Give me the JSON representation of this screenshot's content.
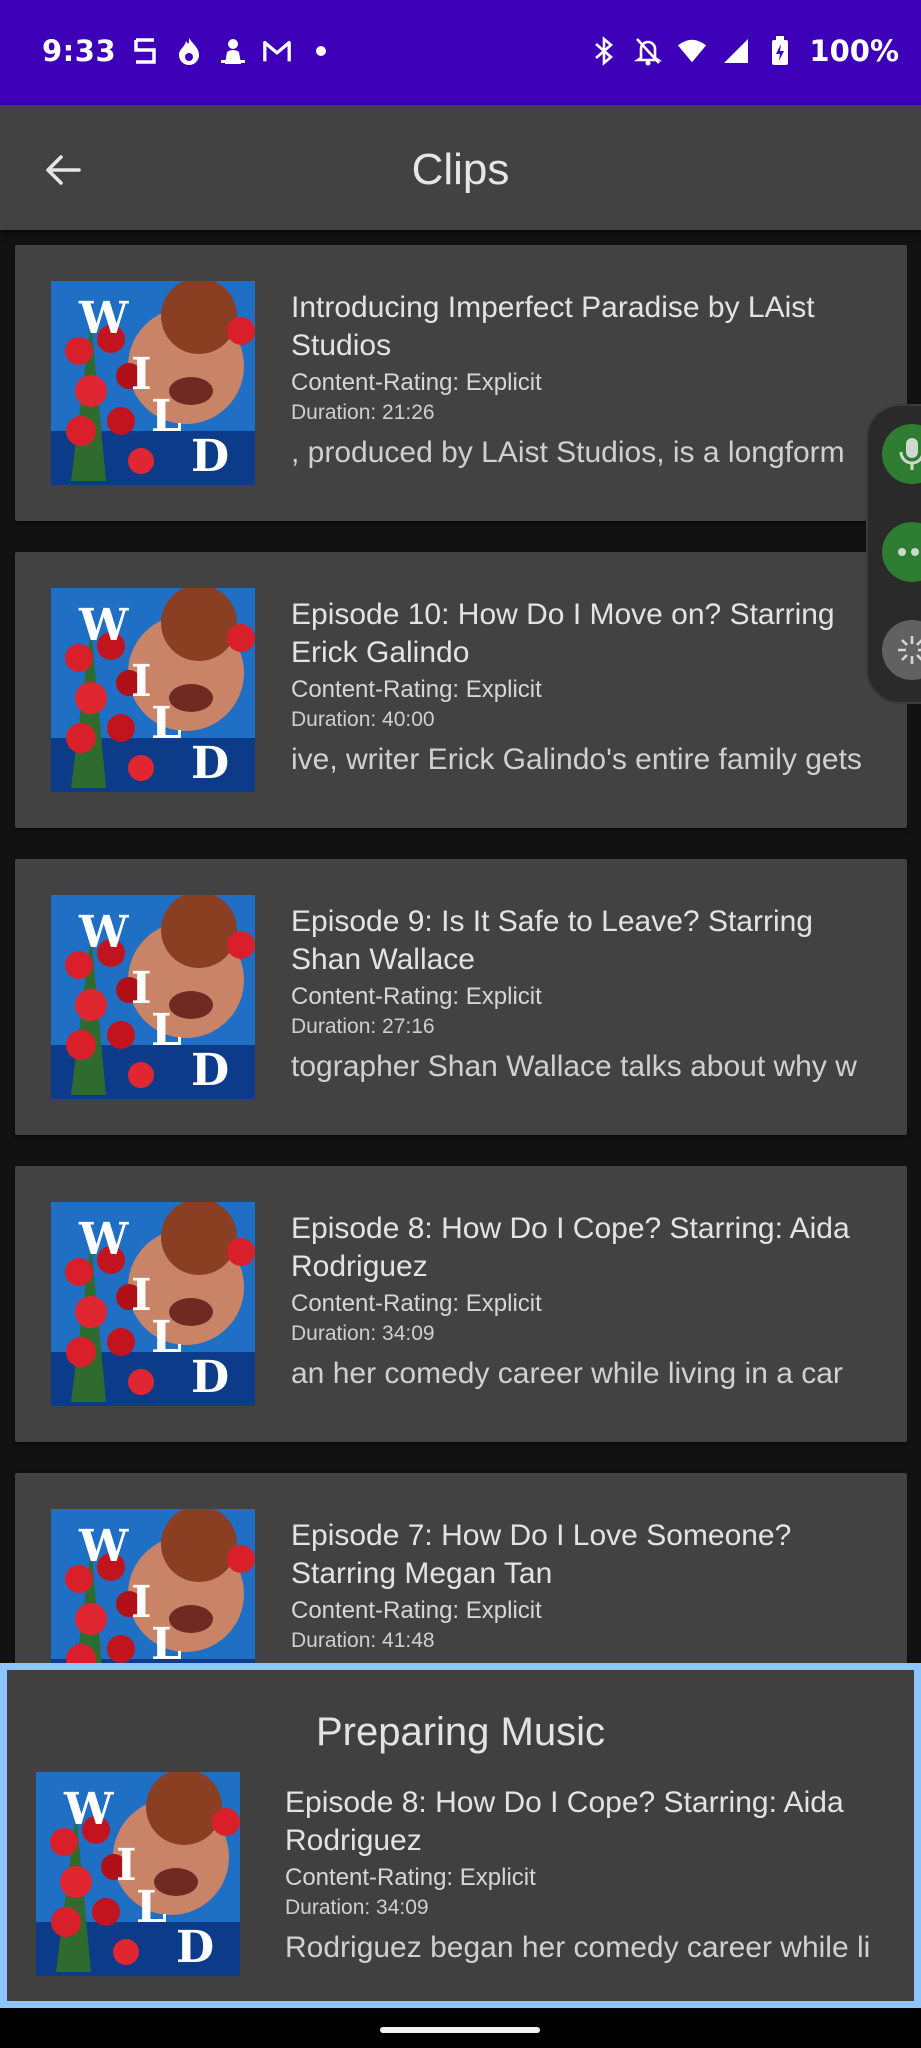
{
  "status_bar": {
    "time": "9:33",
    "battery": "100%",
    "left_icons": [
      "s-app-icon",
      "fire-icon",
      "bug-icon",
      "gmail-icon",
      "dot-icon"
    ],
    "right_icons": [
      "bluetooth-icon",
      "notifications-off-icon",
      "wifi-icon",
      "signal-icon",
      "battery-icon"
    ]
  },
  "app_bar": {
    "title": "Clips",
    "back_icon": "arrow-back-icon"
  },
  "thumbnail": {
    "letters": [
      "W",
      "I",
      "L",
      "D"
    ]
  },
  "clips": [
    {
      "title": "Introducing Imperfect Paradise by LAist Studios",
      "rating": "Content-Rating: Explicit",
      "duration": "Duration: 21:26",
      "description": ", produced by LAist Studios, is a longform"
    },
    {
      "title": "Episode 10: How Do I Move on? Starring Erick Galindo",
      "rating": "Content-Rating: Explicit",
      "duration": "Duration: 40:00",
      "description": "ive, writer Erick Galindo's entire family gets"
    },
    {
      "title": "Episode 9: Is It Safe to Leave? Starring Shan Wallace",
      "rating": "Content-Rating: Explicit",
      "duration": "Duration: 27:16",
      "description": "tographer Shan Wallace talks about why w"
    },
    {
      "title": "Episode 8: How Do I Cope? Starring: Aida Rodriguez",
      "rating": "Content-Rating: Explicit",
      "duration": "Duration: 34:09",
      "description": "an her comedy career while living in a car"
    },
    {
      "title": "Episode 7: How Do I Love Someone? Starring Megan Tan",
      "rating": "Content-Rating: Explicit",
      "duration": "Duration: 41:48",
      "description": ""
    }
  ],
  "now_playing": {
    "status": "Preparing Music",
    "title": "Episode 8: How Do I Cope? Starring: Aida Rodriguez",
    "rating": "Content-Rating: Explicit",
    "duration": "Duration: 34:09",
    "description": "Rodriguez began her comedy career while li"
  },
  "side_bubble": {
    "buttons": [
      "mic-icon",
      "more-icon",
      "magic-icon"
    ],
    "colors": [
      "#2e7d32",
      "#2e7d32",
      "#616161"
    ]
  },
  "colors": {
    "status_bar": "#3d00b8",
    "app_bar": "#424242",
    "card": "#424242",
    "background": "#121212",
    "highlight": "#8ec5ff"
  }
}
